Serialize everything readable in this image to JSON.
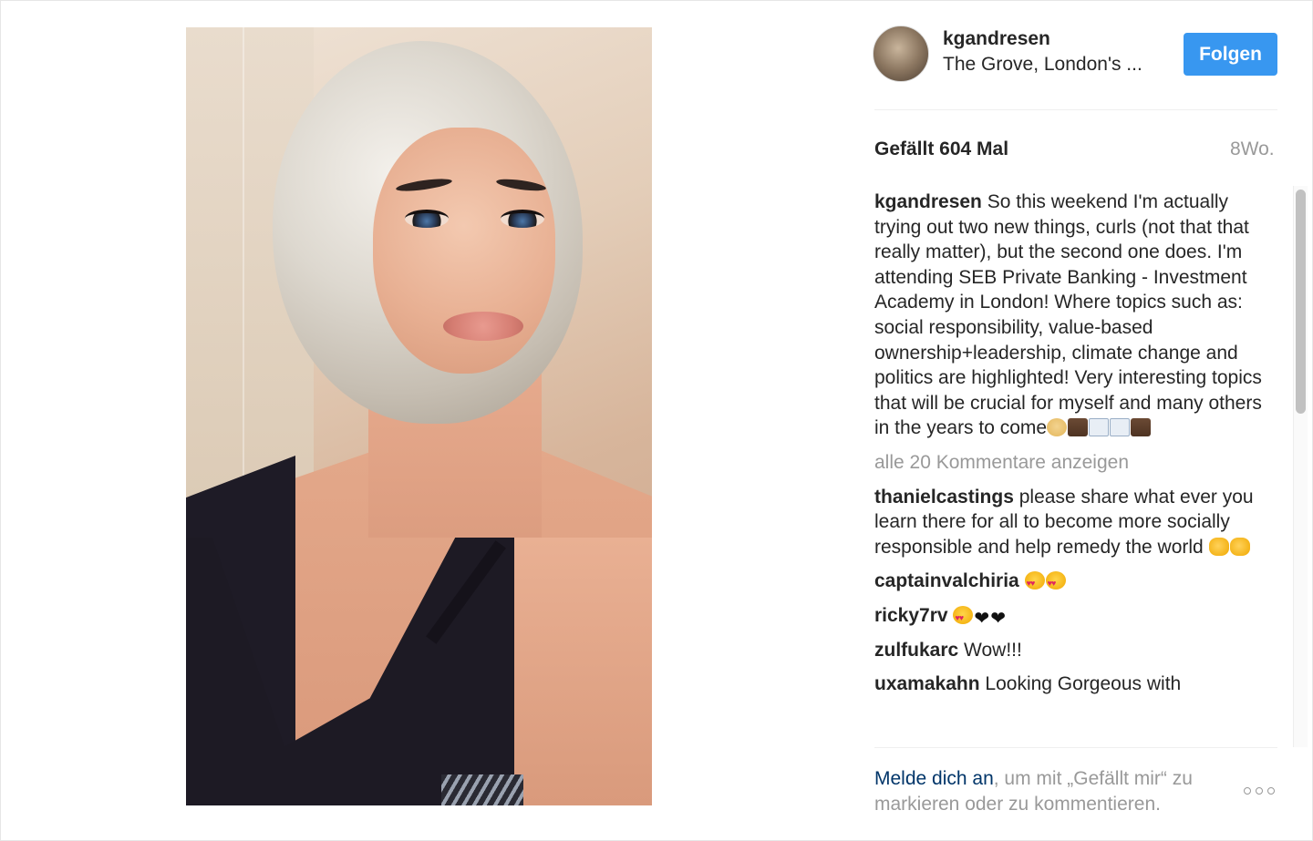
{
  "post": {
    "username": "kgandresen",
    "location": "The Grove, London's ...",
    "follow_label": "Folgen",
    "likes": "Gefällt 604 Mal",
    "age": "8Wo."
  },
  "comments": {
    "caption_user": "kgandresen",
    "caption_text": "So this weekend I'm actually trying out two new things, curls (not that that really matter), but the second one does. I'm attending SEB Private Banking - Investment Academy in London! Where topics such as: social responsibility, value-based ownership+leadership, climate change and politics are highlighted! Very interesting topics that will be crucial for myself and many others in the years to come",
    "view_all": "alle 20 Kommentare anzeigen",
    "items": [
      {
        "user": "thanielcastings",
        "text": "please share what ever you learn there for all to become more socially responsible and help remedy the world"
      },
      {
        "user": "captainvalchiria",
        "text": ""
      },
      {
        "user": "ricky7rv",
        "text": ""
      },
      {
        "user": "zulfukarc",
        "text": "Wow!!!"
      },
      {
        "user": "uxamakahn",
        "text": "Looking Gorgeous with"
      }
    ]
  },
  "footer": {
    "login_link": "Melde dich an",
    "login_rest": ", um mit „Gefällt mir“ zu markieren oder zu kommentieren."
  }
}
